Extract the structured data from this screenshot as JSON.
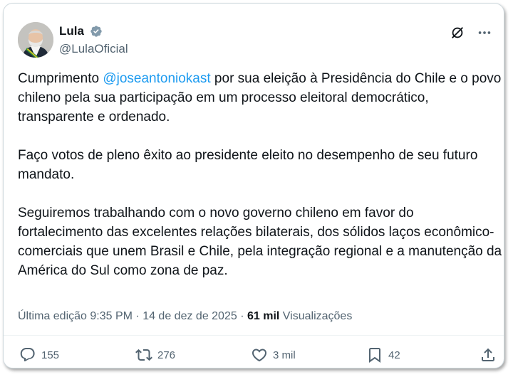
{
  "post": {
    "author": {
      "display_name": "Lula",
      "handle": "@LulaOficial",
      "verified_icon": "verified-badge-icon"
    },
    "body": {
      "p1_prefix": "Cumprimento ",
      "p1_mention": "@joseantoniokast",
      "p1_suffix": " por sua eleição à Presidência do Chile e o povo chileno pela sua participação em um processo eleitoral democrático, transparente e ordenado.",
      "p2": "Faço votos de pleno êxito ao presidente eleito no desempenho de seu futuro mandato.",
      "p3": "Seguiremos trabalhando com o novo governo chileno em favor do fortalecimento das excelentes relações bilaterais, dos sólidos laços econômico-comerciais que unem Brasil e Chile, pela integração regional e a manutenção da América do Sul como zona de paz."
    },
    "meta": {
      "edited_label": "Última edição 9:35 PM",
      "separator": " · ",
      "date": "14 de dez de 2025",
      "separator2": " · ",
      "views_count": "61 mil",
      "views_label": " Visualizações"
    },
    "actions": {
      "replies": "155",
      "reposts": "276",
      "likes": "3 mil",
      "bookmarks": "42"
    }
  },
  "colors": {
    "link": "#1d9bf0",
    "secondary_text": "#536471",
    "primary_text": "#0f1419",
    "border": "#cfd9de"
  }
}
